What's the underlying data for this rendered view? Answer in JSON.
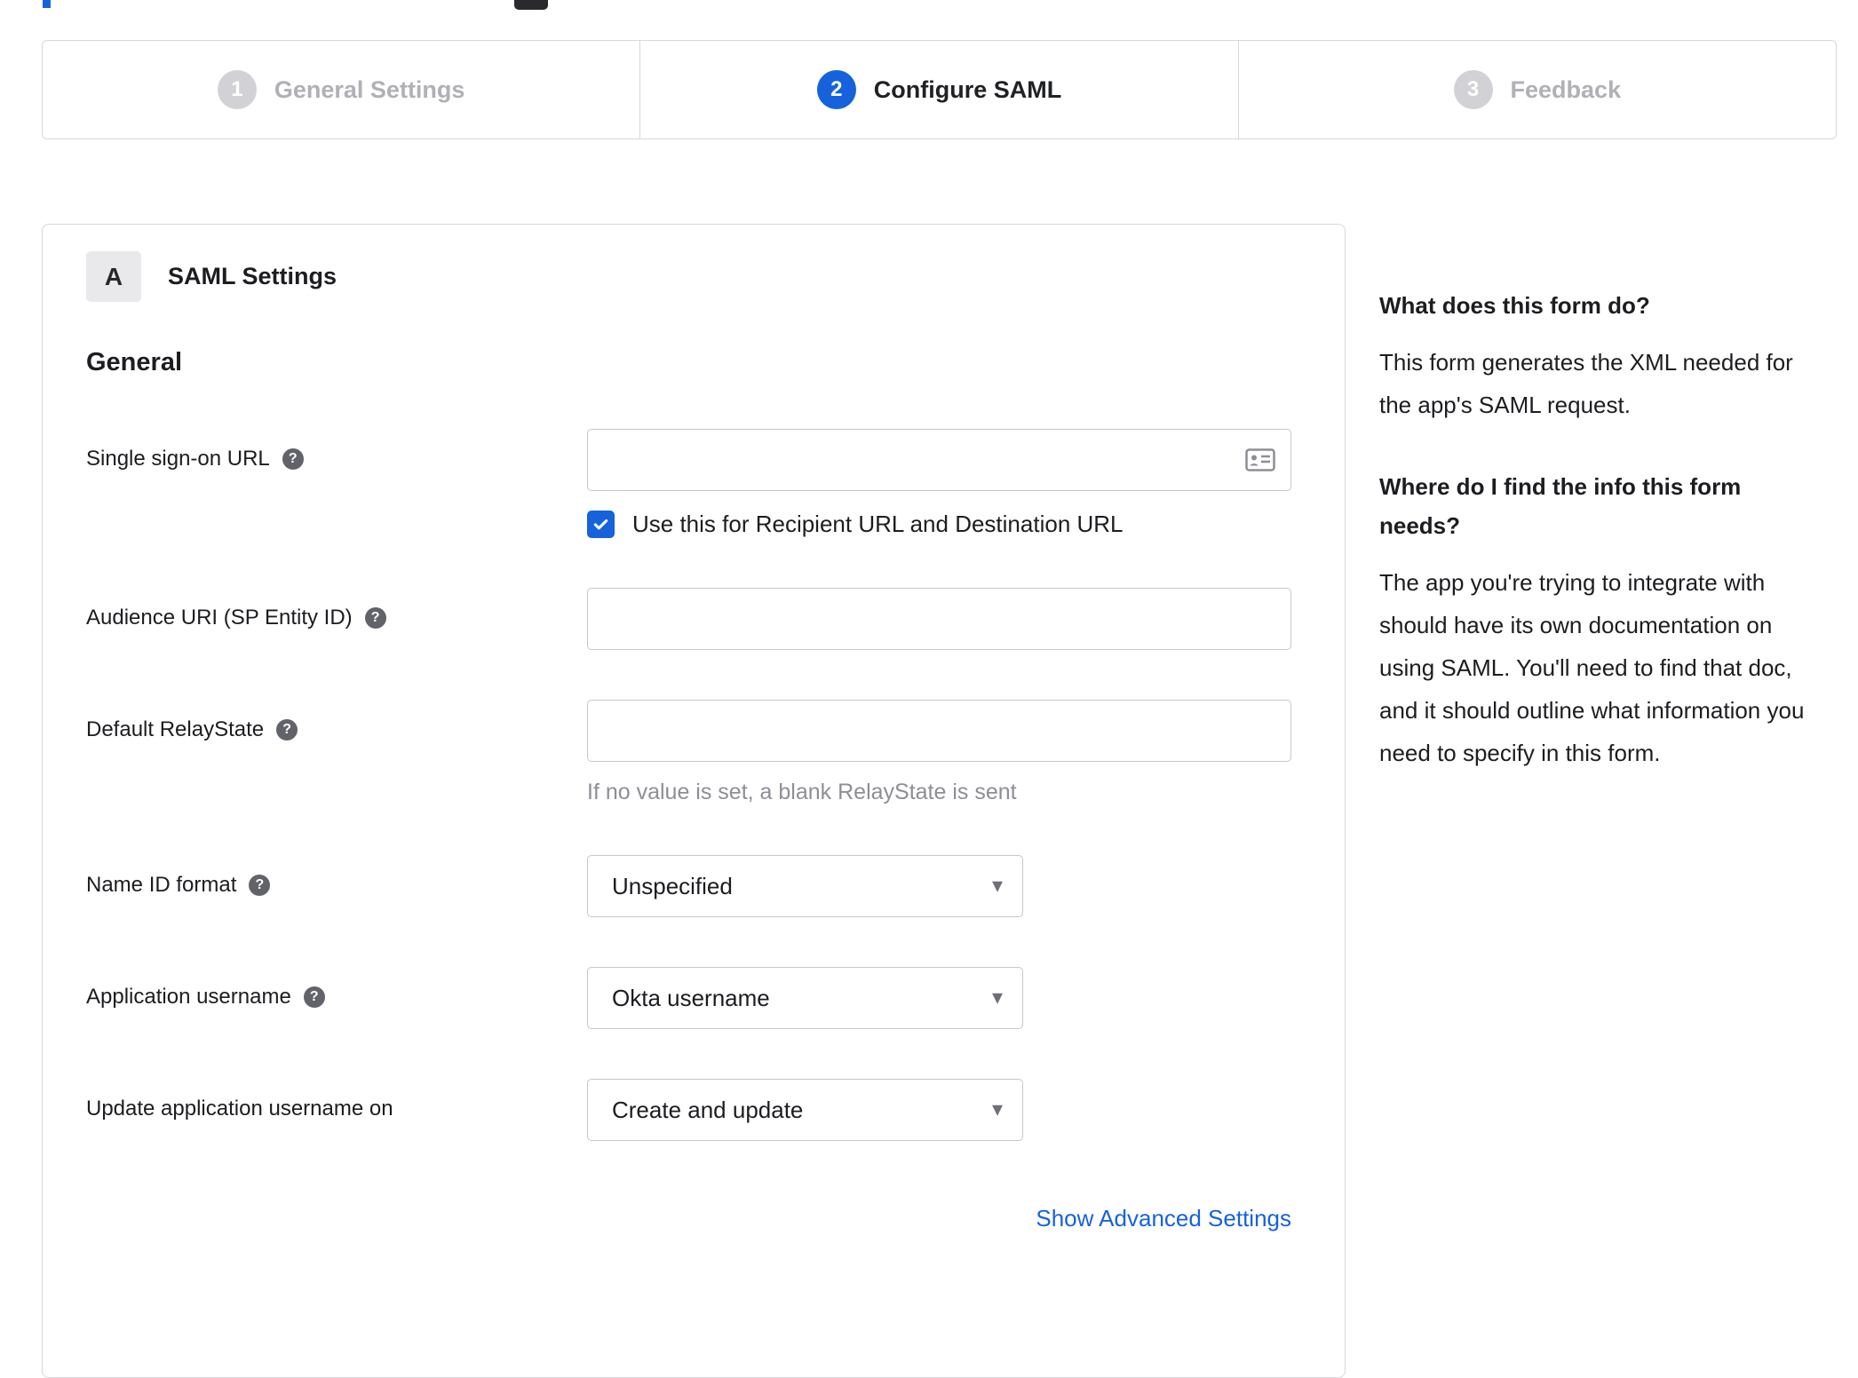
{
  "stepper": {
    "active_step": "Configure SAML",
    "steps": [
      {
        "number": "1",
        "label": "General Settings",
        "state": "inactive"
      },
      {
        "number": "2",
        "label": "Configure SAML",
        "state": "active"
      },
      {
        "number": "3",
        "label": "Feedback",
        "state": "inactive"
      }
    ]
  },
  "panel": {
    "section_badge": "A",
    "section_title": "SAML Settings",
    "group_title": "General",
    "fields": {
      "sso_url": {
        "label": "Single sign-on URL",
        "value": ""
      },
      "sso_checkbox": {
        "label": "Use this for Recipient URL and Destination URL",
        "checked": true
      },
      "audience_uri": {
        "label": "Audience URI (SP Entity ID)",
        "value": ""
      },
      "relay_state": {
        "label": "Default RelayState",
        "value": "",
        "hint": "If no value is set, a blank RelayState is sent"
      },
      "name_id_format": {
        "label": "Name ID format",
        "value": "Unspecified"
      },
      "app_username": {
        "label": "Application username",
        "value": "Okta username"
      },
      "update_app_username": {
        "label": "Update application username on",
        "value": "Create and update"
      }
    },
    "advanced_link": "Show Advanced Settings"
  },
  "help_panel": {
    "sections": [
      {
        "heading": "What does this form do?",
        "body": "This form generates the XML needed for the app's SAML request."
      },
      {
        "heading": "Where do I find the info this form needs?",
        "body": "The app you're trying to integrate with should have its own documentation on using SAML. You'll need to find that doc, and it should outline what information you need to specify in this form."
      }
    ]
  },
  "icons": {
    "help": "?",
    "dropdown_arrow": "▾"
  },
  "colors": {
    "accent_blue": "#1662dd",
    "inactive_gray": "#d2d2d6",
    "border_gray": "#d7d7dc",
    "text_dark": "#1d1d21",
    "muted_text": "#8e8e96"
  }
}
